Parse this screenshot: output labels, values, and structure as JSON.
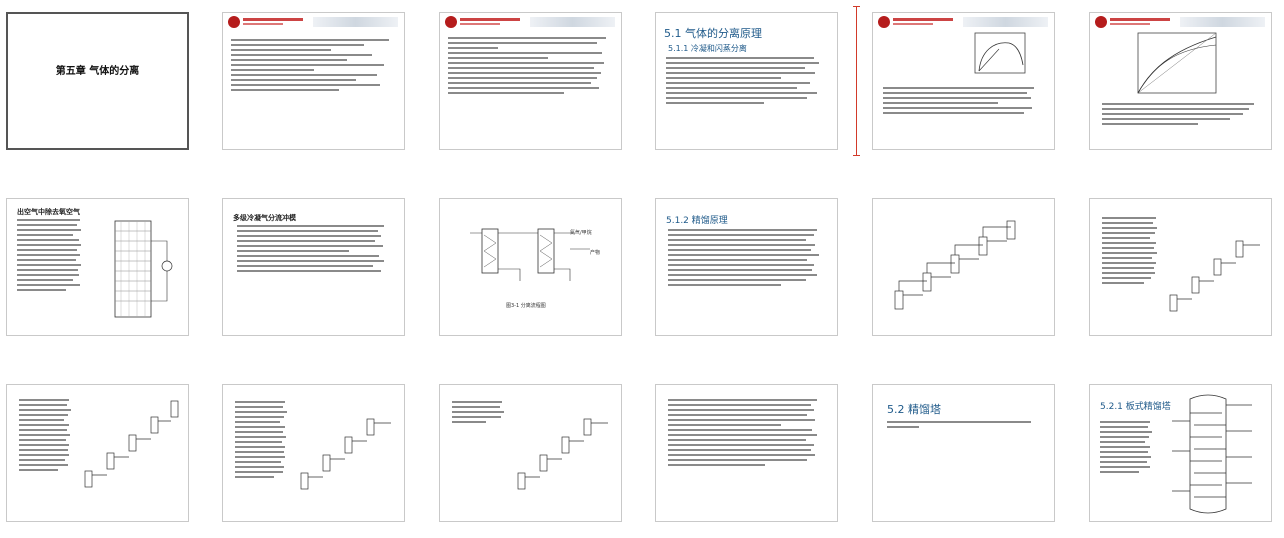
{
  "slides": [
    {
      "id": 1,
      "chapter_title": "第五章  气体的分离"
    },
    {
      "id": 2
    },
    {
      "id": 3
    },
    {
      "id": 4,
      "heading": "5.1  气体的分离原理",
      "subheading": "5.1.1  冷凝和闪蒸分离"
    },
    {
      "id": 5
    },
    {
      "id": 6
    },
    {
      "id": 7,
      "heading": "出空气中除去氧空气"
    },
    {
      "id": 8,
      "heading": "多级冷凝气分流冲模"
    },
    {
      "id": 9,
      "label_a": "氮气/甲烷",
      "label_b": "产物",
      "label_c": "图3-1 分离流程图"
    },
    {
      "id": 10,
      "heading": "5.1.2  精馏原理"
    },
    {
      "id": 11
    },
    {
      "id": 12
    },
    {
      "id": 13
    },
    {
      "id": 14
    },
    {
      "id": 15
    },
    {
      "id": 16
    },
    {
      "id": 17,
      "heading": "5.2  精馏塔"
    },
    {
      "id": 18,
      "heading": "5.2.1  板式精馏塔"
    }
  ],
  "colors": {
    "accent_red": "#b51c1c",
    "heading_blue": "#1f5a8a",
    "border": "#c9c9c9"
  }
}
